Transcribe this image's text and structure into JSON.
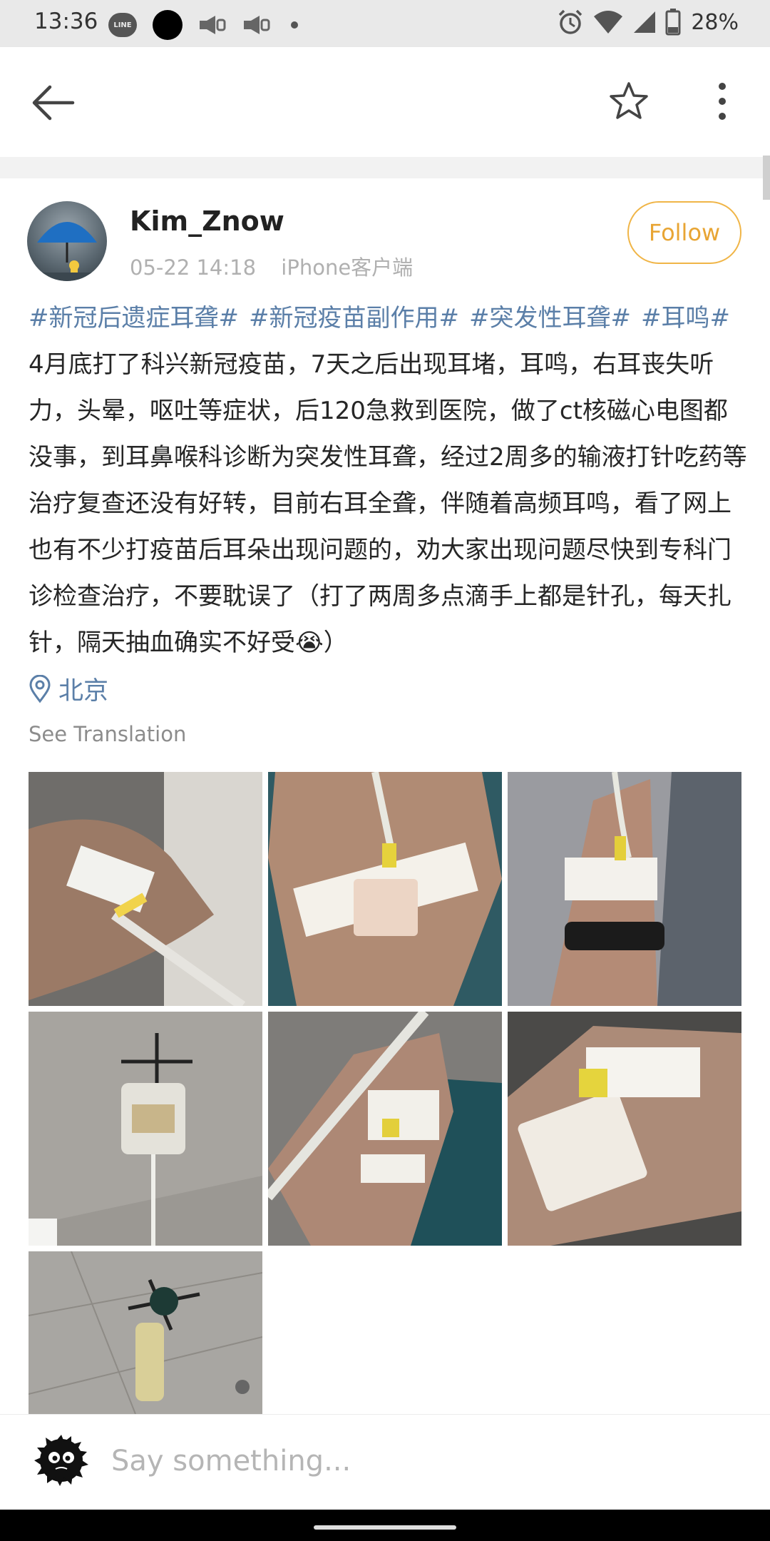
{
  "status_bar": {
    "time": "13:36",
    "line_label": "LINE",
    "battery": "28%"
  },
  "app_bar": {
    "back_icon": "arrow-left-icon",
    "favorite_icon": "star-outline-icon",
    "more_icon": "more-vertical-icon"
  },
  "post": {
    "username": "Kim_Znow",
    "date": "05-22 14:18",
    "source": "iPhone客户端",
    "follow_label": "Follow",
    "hashtags": [
      "#新冠后遗症耳聋#",
      "#新冠疫苗副作用#",
      "#突发性耳聋#",
      "#耳鸣#"
    ],
    "text": "4月底打了科兴新冠疫苗，7天之后出现耳堵，耳鸣，右耳丧失听力，头晕，呕吐等症状，后120急救到医院，做了ct核磁心电图都没事，到耳鼻喉科诊断为突发性耳聋，经过2周多的输液打针吃药等治疗复查还没有好转，目前右耳全聋，伴随着高频耳鸣，看了网上也有不少打疫苗后耳朵出现问题的，劝大家出现问题尽快到专科门诊检查治疗，不要耽误了（打了两周多点滴手上都是针孔，每天扎针，隔天抽血确实不好受",
    "emoji": "😭",
    "text_end": "）",
    "location": "北京",
    "translation_label": "See Translation",
    "photo_count": 7
  },
  "comment_bar": {
    "placeholder": "Say something..."
  },
  "colors": {
    "link": "#5b7fa8",
    "follow": "#e8a534"
  }
}
